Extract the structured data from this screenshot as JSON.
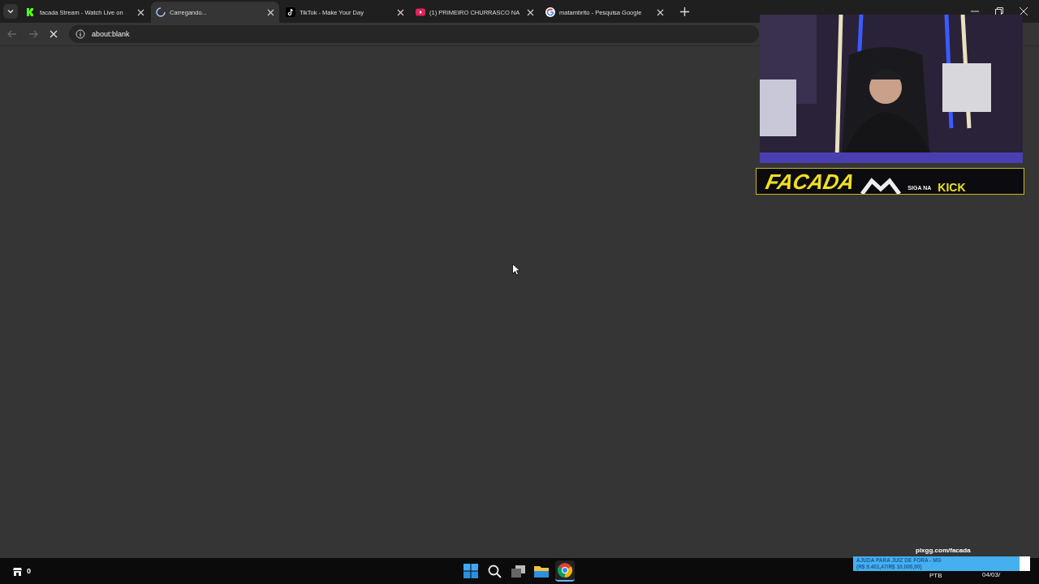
{
  "tabs": [
    {
      "title": "facada Stream - Watch Live on",
      "kind": "kick",
      "selected": false
    },
    {
      "title": "Carregando...",
      "kind": "loading",
      "selected": true
    },
    {
      "title": "TikTok - Make Your Day",
      "kind": "tiktok",
      "selected": false
    },
    {
      "title": "(1) PRIMEIRO CHURRASCO NA",
      "kind": "youtube",
      "selected": false
    },
    {
      "title": "matambrito - Pesquisa Google",
      "kind": "google",
      "selected": false
    }
  ],
  "address_bar": {
    "url": "about:blank",
    "loading": true
  },
  "stream_overlay": {
    "banner": {
      "name": "FACADA",
      "follow_text": "SIGA NA",
      "platform": "KICK"
    },
    "pix_link": "pixgg.com/facada",
    "goal": {
      "title": "AJUDA PARA JUIZ DE FORA - MG",
      "amount": "(R$ 9.401,47/R$ 10.000,00)",
      "level": 0.94
    }
  },
  "taskbar": {
    "widget_count": "0",
    "apps": [
      {
        "kind": "start"
      },
      {
        "kind": "search"
      },
      {
        "kind": "taskview"
      },
      {
        "kind": "explorer"
      },
      {
        "kind": "chrome",
        "selected": true
      }
    ],
    "language": "PTB",
    "date": "04/03/"
  }
}
